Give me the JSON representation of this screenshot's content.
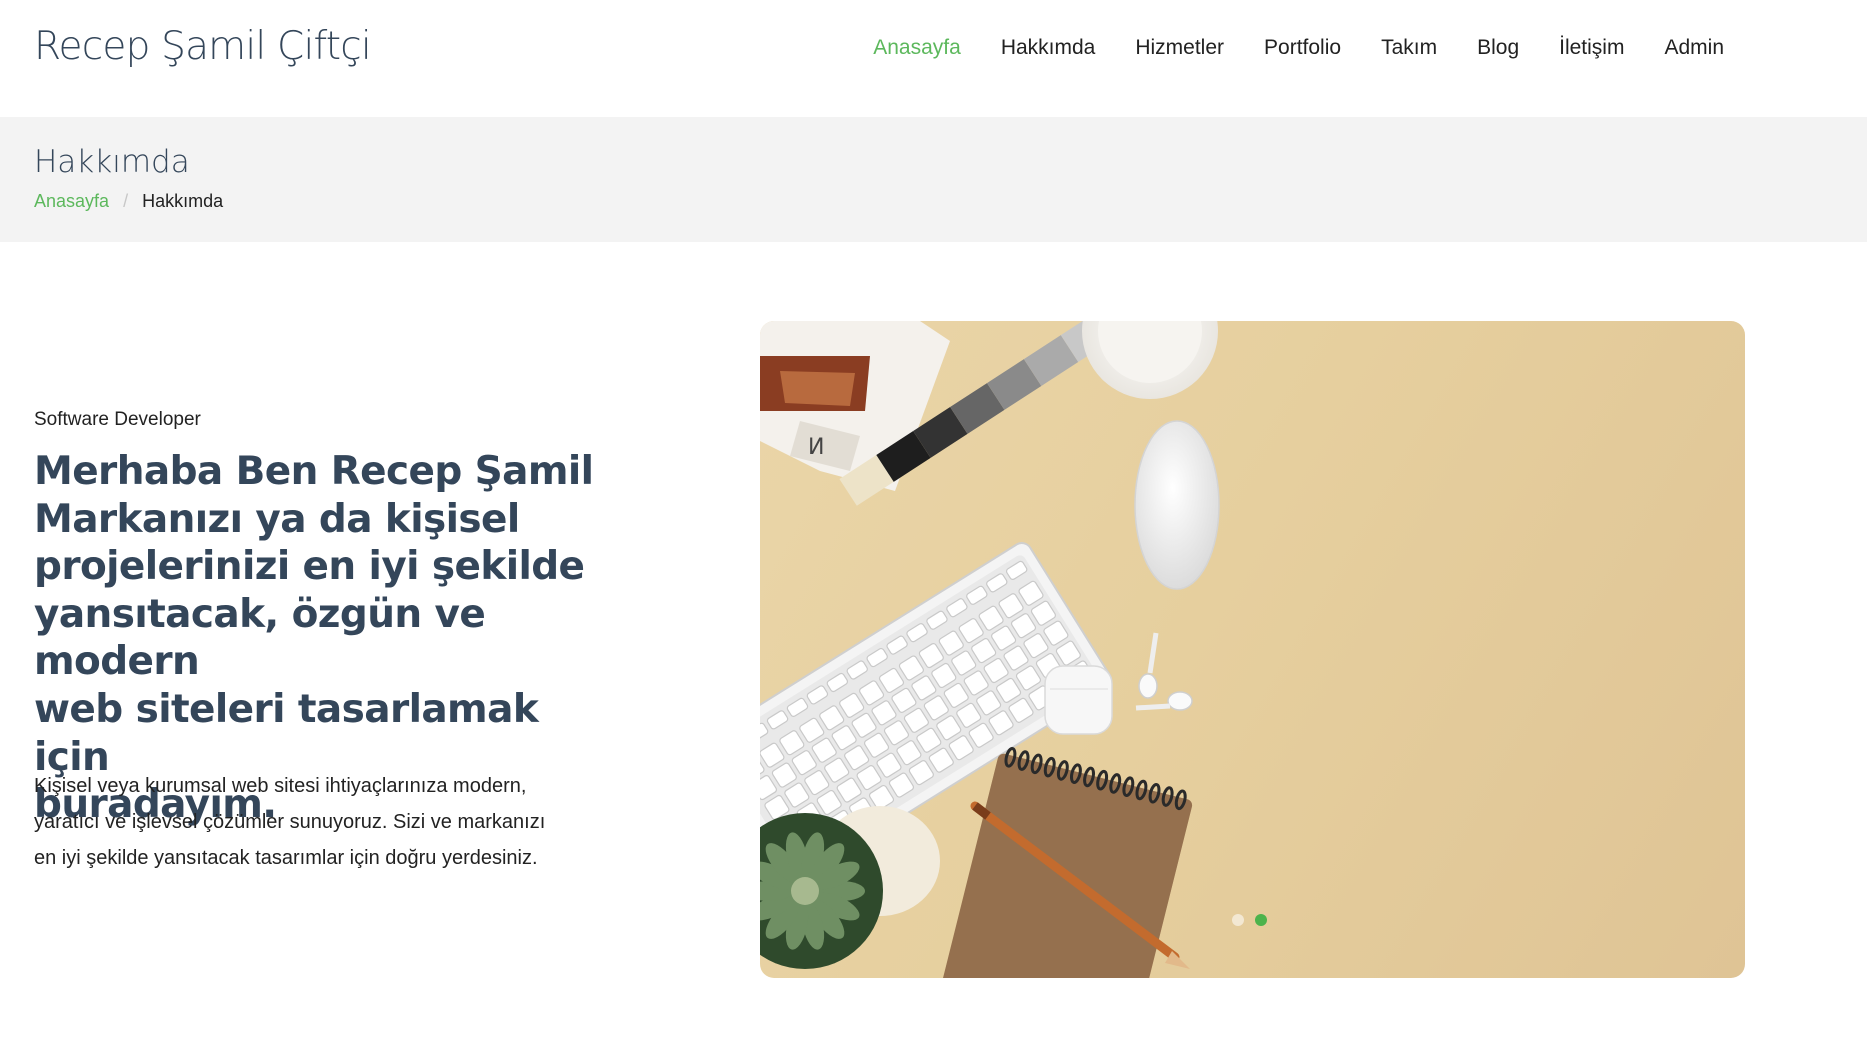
{
  "brand": "Recep Şamil Çiftçi",
  "nav": [
    {
      "label": "Anasayfa",
      "active": true
    },
    {
      "label": "Hakkımda",
      "active": false
    },
    {
      "label": "Hizmetler",
      "active": false
    },
    {
      "label": "Portfolio",
      "active": false
    },
    {
      "label": "Takım",
      "active": false
    },
    {
      "label": "Blog",
      "active": false
    },
    {
      "label": "İletişim",
      "active": false
    },
    {
      "label": "Admin",
      "active": false
    }
  ],
  "page_header": {
    "title": "Hakkımda",
    "breadcrumb": {
      "home": "Anasayfa",
      "separator": "/",
      "current": "Hakkımda"
    }
  },
  "about": {
    "eyebrow": "Software Developer",
    "headline_lines": [
      "Merhaba Ben Recep Şamil",
      "Markanızı ya da kişisel",
      "projelerinizi en iyi şekilde",
      "yansıtacak, özgün ve modern",
      "web siteleri tasarlamak için",
      "buradayım."
    ],
    "lead_lines": [
      "Kişisel veya kurumsal web sitesi ihtiyaçlarınıza modern,",
      "yaratıcı ve işlevsel çözümler sunuyoruz. Sizi ve markanızı",
      "en iyi şekilde yansıtacak tasarımlar için doğru yerdesiniz."
    ]
  },
  "carousel": {
    "image_subject": "desk flat-lay: keyboard, mouse, earbuds, notebook, pencil, succulent, coffee cup, color swatches",
    "slide_count": 2,
    "active_slide": 2
  },
  "colors": {
    "accent": "#5cb85c",
    "heading": "#34465a",
    "band": "#f3f3f3",
    "image_bg": "#e6cf9e"
  }
}
